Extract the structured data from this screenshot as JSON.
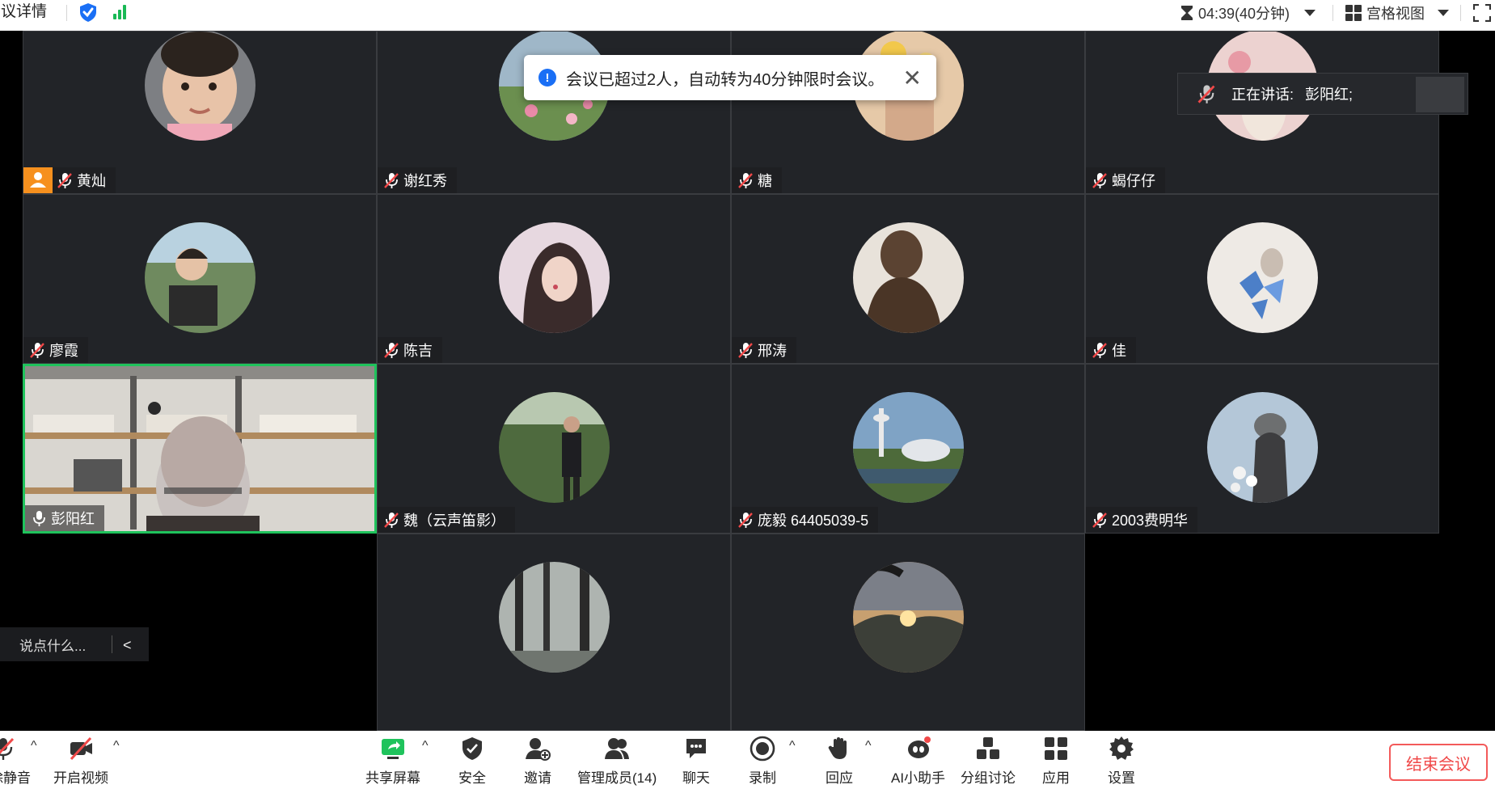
{
  "topbar": {
    "meeting_details": "会议详情",
    "timer": "04:39(40分钟)",
    "view_mode": "宫格视图"
  },
  "toast": {
    "message": "会议已超过2人，自动转为40分钟限时会议。",
    "close": "✕"
  },
  "speaking": {
    "label": "正在讲话:",
    "speaker": "彭阳红;"
  },
  "participants": [
    {
      "name": "黄灿",
      "muted": true,
      "host": true,
      "avatar_color": "#d8b8a6"
    },
    {
      "name": "谢红秀",
      "muted": true,
      "avatar_color": "#7a9a6a"
    },
    {
      "name": "糖",
      "muted": true,
      "avatar_color": "#e6c9a8"
    },
    {
      "name": "蝎仔仔",
      "muted": true,
      "avatar_color": "#e9c8c8"
    },
    {
      "name": "廖霞",
      "muted": true,
      "avatar_color": "#6f8a5f"
    },
    {
      "name": "陈吉",
      "muted": true,
      "avatar_color": "#c9a6b6"
    },
    {
      "name": "邢涛",
      "muted": true,
      "avatar_color": "#5b4332"
    },
    {
      "name": "佳",
      "muted": true,
      "avatar_color": "#eeeae5"
    },
    {
      "name": "彭阳红",
      "muted": false,
      "video_on": true
    },
    {
      "name": "魏（云声笛影）",
      "muted": true,
      "avatar_color": "#4e6a3e"
    },
    {
      "name": "庞毅  64405039-5",
      "muted": true,
      "avatar_color": "#7fa3c5"
    },
    {
      "name": "2003费明华",
      "muted": true,
      "avatar_color": "#b4c7d8"
    },
    {
      "name": "",
      "muted": true,
      "avatar_color": "#8f9590"
    },
    {
      "name": "",
      "muted": true,
      "avatar_color": "#c7a070"
    }
  ],
  "chat_input": {
    "placeholder": "说点什么...",
    "collapse": "<"
  },
  "toolbar": {
    "mute": "解除静音",
    "video": "开启视频",
    "share": "共享屏幕",
    "security": "安全",
    "invite": "邀请",
    "members": "管理成员(14)",
    "chat": "聊天",
    "record": "录制",
    "react": "回应",
    "ai": "AI小助手",
    "breakout": "分组讨论",
    "apps": "应用",
    "settings": "设置",
    "end": "结束会议"
  },
  "colors": {
    "active_speaker": "#1fc35c",
    "end_button": "#f04848",
    "host_badge": "#f6901e",
    "info_blue": "#1a6ff5",
    "shield_blue": "#1a6ff5"
  }
}
